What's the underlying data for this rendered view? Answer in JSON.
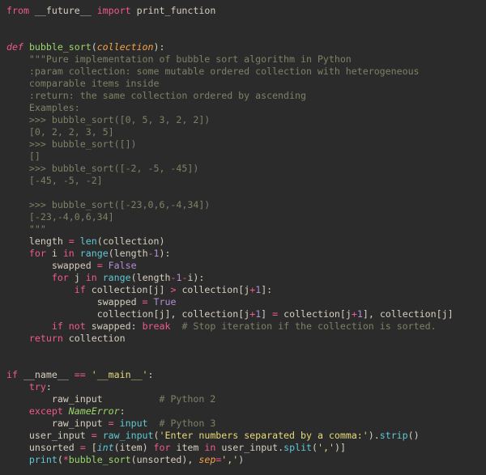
{
  "line1": {
    "from": "from",
    "mod": "__future__",
    "import": "import",
    "name": "print_function"
  },
  "blank2": "",
  "blank3": "",
  "line4": {
    "def": "def",
    "name": "bubble_sort",
    "lp": "(",
    "param": "collection",
    "rp": ")",
    "colon": ":"
  },
  "line5": "    \"\"\"Pure implementation of bubble sort algorithm in Python",
  "line6": "    :param collection: some mutable ordered collection with heterogeneous",
  "line7": "    comparable items inside",
  "line8": "    :return: the same collection ordered by ascending",
  "line9": "    Examples:",
  "line10": "    >>> bubble_sort([0, 5, 3, 2, 2])",
  "line11": "    [0, 2, 2, 3, 5]",
  "line12": "    >>> bubble_sort([])",
  "line13": "    []",
  "line14": "    >>> bubble_sort([-2, -5, -45])",
  "line15": "    [-45, -5, -2]",
  "blank16": "",
  "line17": "    >>> bubble_sort([-23,0,6,-4,34])",
  "line18": "    [-23,-4,0,6,34]",
  "line19": "    \"\"\"",
  "line20": {
    "indent": "    ",
    "length": "length",
    "eq": " = ",
    "len": "len",
    "lp": "(",
    "coll": "collection",
    "rp": ")"
  },
  "line21": {
    "indent": "    ",
    "for": "for",
    "sp1": " ",
    "i": "i",
    "sp2": " ",
    "in": "in",
    "sp3": " ",
    "range": "range",
    "lp": "(",
    "length": "length",
    "minus": "-",
    "one": "1",
    "rp": ")",
    "colon": ":"
  },
  "line22": {
    "indent": "        ",
    "swapped": "swapped",
    "eq": " = ",
    "false": "False"
  },
  "line23": {
    "indent": "        ",
    "for": "for",
    "sp1": " ",
    "j": "j",
    "sp2": " ",
    "in": "in",
    "sp3": " ",
    "range": "range",
    "lp": "(",
    "length": "length",
    "m1": "-",
    "one": "1",
    "m2": "-",
    "i": "i",
    "rp": ")",
    "colon": ":"
  },
  "line24": {
    "indent": "            ",
    "if": "if",
    "sp": " ",
    "coll1": "collection",
    "lb1": "[",
    "j1": "j",
    "rb1": "]",
    "gt": " > ",
    "coll2": "collection",
    "lb2": "[",
    "j2": "j",
    "plus": "+",
    "one": "1",
    "rb2": "]",
    "colon": ":"
  },
  "line25": {
    "indent": "                ",
    "swapped": "swapped",
    "eq": " = ",
    "true": "True"
  },
  "line26": {
    "indent": "                ",
    "c1": "collection",
    "lb1": "[",
    "j1": "j",
    "rb1": "]",
    "cm1": ", ",
    "c2": "collection",
    "lb2": "[",
    "j2": "j",
    "p2": "+",
    "o2": "1",
    "rb2": "]",
    "eq": " = ",
    "c3": "collection",
    "lb3": "[",
    "j3": "j",
    "p3": "+",
    "o3": "1",
    "rb3": "]",
    "cm2": ", ",
    "c4": "collection",
    "lb4": "[",
    "j4": "j",
    "rb4": "]"
  },
  "line27": {
    "indent": "        ",
    "if": "if",
    "sp1": " ",
    "not": "not",
    "sp2": " ",
    "swapped": "swapped",
    "colon": ":",
    "sp3": " ",
    "break": "break",
    "sp4": "  ",
    "cmt": "# Stop iteration if the collection is sorted."
  },
  "line28": {
    "indent": "    ",
    "return": "return",
    "sp": " ",
    "coll": "collection"
  },
  "blank29": "",
  "blank30": "",
  "line31": {
    "if": "if",
    "sp1": " ",
    "name": "__name__",
    "sp2": " ",
    "eq": "==",
    "sp3": " ",
    "str": "'__main__'",
    "colon": ":"
  },
  "line32": {
    "indent": "    ",
    "try": "try",
    "colon": ":"
  },
  "line33": {
    "indent": "        ",
    "raw": "raw_input",
    "pad": "          ",
    "cmt": "# Python 2"
  },
  "line34": {
    "indent": "    ",
    "except": "except",
    "sp": " ",
    "err": "NameError",
    "colon": ":"
  },
  "line35": {
    "indent": "        ",
    "raw": "raw_input",
    "eq": " = ",
    "input": "input",
    "pad": "  ",
    "cmt": "# Python 3"
  },
  "line36": {
    "indent": "    ",
    "ui": "user_input",
    "eq": " = ",
    "raw": "raw_input",
    "lp": "(",
    "str": "'Enter numbers separated by a comma:'",
    "rp": ")",
    "dot": ".",
    "strip": "strip",
    "lp2": "(",
    "rp2": ")"
  },
  "line37": {
    "indent": "    ",
    "uns": "unsorted",
    "eq": " = ",
    "lb": "[",
    "int": "int",
    "lp": "(",
    "item1": "item",
    "rp": ")",
    "sp1": " ",
    "for": "for",
    "sp2": " ",
    "item2": "item",
    "sp3": " ",
    "in": "in",
    "sp4": " ",
    "ui": "user_input",
    "dot": ".",
    "split": "split",
    "lp2": "(",
    "str": "','",
    "rp2": ")",
    "rb": "]"
  },
  "line38": {
    "indent": "    ",
    "print": "print",
    "lp": "(",
    "star": "*",
    "bs": "bubble_sort",
    "lp2": "(",
    "uns": "unsorted",
    "rp2": ")",
    "cm": ",",
    "sp": " ",
    "sep": "sep",
    "eq": "=",
    "str": "','",
    "rp": ")"
  }
}
